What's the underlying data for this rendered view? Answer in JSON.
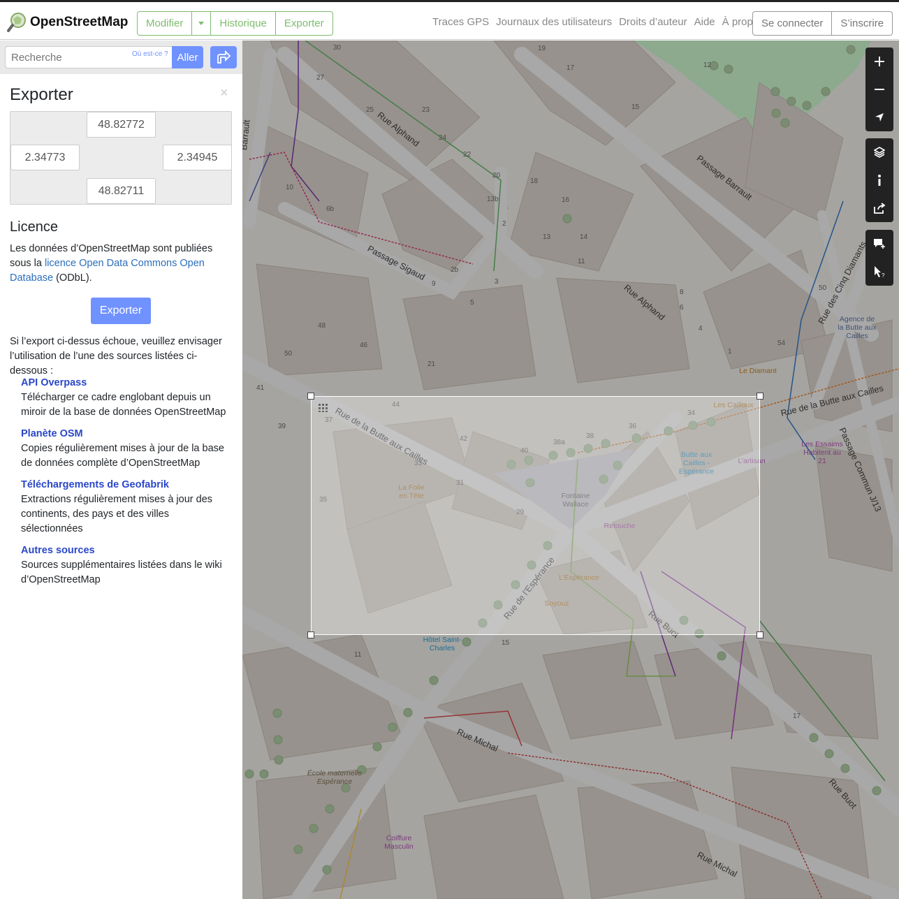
{
  "header": {
    "logo_text": "OpenStreetMap",
    "edit_label": "Modifier",
    "history_label": "Historique",
    "export_label": "Exporter",
    "nav": [
      "Traces GPS",
      "Journaux des utilisateurs",
      "Droits d’auteur",
      "Aide",
      "À propos"
    ],
    "login_label": "Se connecter",
    "signup_label": "S’inscrire"
  },
  "search": {
    "placeholder": "Recherche",
    "where_label": "Où est-ce ?",
    "go_label": "Aller"
  },
  "export": {
    "title": "Exporter",
    "bbox": {
      "max_lat": "48.82772",
      "min_lon": "2.34773",
      "max_lon": "2.34945",
      "min_lat": "48.82711"
    },
    "licence_title": "Licence",
    "licence_text_1": "Les données d’OpenStreetMap sont publiées sous la ",
    "licence_link": "licence Open Data Commons Open Database",
    "licence_text_2": " (ODbL).",
    "export_button": "Exporter",
    "fallback_text": "Si l’export ci-dessus échoue, veuillez envisager l’utilisation de l’une des sources listées ci-dessous :",
    "sources": [
      {
        "title": "API Overpass",
        "desc": "Télécharger ce cadre englobant depuis un miroir de la base de données OpenStreetMap"
      },
      {
        "title": "Planète OSM",
        "desc": "Copies régulièrement mises à jour de la base de données complète d’OpenStreetMap"
      },
      {
        "title": "Téléchargements de Geofabrik",
        "desc": "Extractions régulièrement mises à jour des continents, des pays et des villes sélectionnées"
      },
      {
        "title": "Autres sources",
        "desc": "Sources supplémentaires listées dans le wiki d’OpenStreetMap"
      }
    ]
  },
  "map": {
    "streets": [
      "Rue Alphand",
      "Passage Barrault",
      "Passage Sigaud",
      "Rue Alphand",
      "Rue des Cinq Diamants",
      "Rue de la Butte aux Cailles",
      "Rue de la Butte aux Cailles",
      "Passage Commun J/13",
      "Rue de l’Espérance",
      "Rue Buot",
      "Rue Michal",
      "Rue Michal",
      "Rue Buot",
      "Barrault"
    ],
    "pois": [
      "La Folie en Tête",
      "Fontaine Wallace",
      "Retouche",
      "L’Espérance",
      "Soyouz",
      "Hôtel Saint-Charles",
      "Butte aux Cailles - Espérance",
      "L’artisan",
      "Les Cailloux",
      "Le Diamant",
      "Agence de la Butte aux Cailles",
      "Les Essaims Habitent au 21",
      "École maternelle Espérance",
      "Coiffure Masculin"
    ],
    "numbers": [
      "30",
      "19",
      "27",
      "25",
      "23",
      "24",
      "22",
      "20",
      "18",
      "17",
      "15",
      "13b",
      "16",
      "14",
      "13",
      "11",
      "9",
      "2",
      "3",
      "5",
      "4",
      "6",
      "8",
      "12",
      "10",
      "1",
      "21",
      "29",
      "31",
      "33",
      "35",
      "37",
      "38a",
      "38",
      "36",
      "34",
      "40",
      "42",
      "44",
      "46",
      "48",
      "50",
      "41",
      "39",
      "2b",
      "6b",
      "54",
      "50",
      "17",
      "15",
      "11"
    ]
  },
  "colors": {
    "osm_green": "#7ebc6f",
    "accent_blue": "#7092ff",
    "link_blue": "#2a47c8",
    "map_building": "#d9d0c9",
    "map_road": "#ffffff",
    "map_park": "#c8facc",
    "control_dark": "#222222"
  },
  "icons": [
    "osm-logo-icon",
    "caret-down-icon",
    "directions-icon",
    "close-icon",
    "zoom-in-icon",
    "zoom-out-icon",
    "locate-icon",
    "layers-icon",
    "info-icon",
    "share-icon",
    "note-add-icon",
    "query-icon"
  ]
}
